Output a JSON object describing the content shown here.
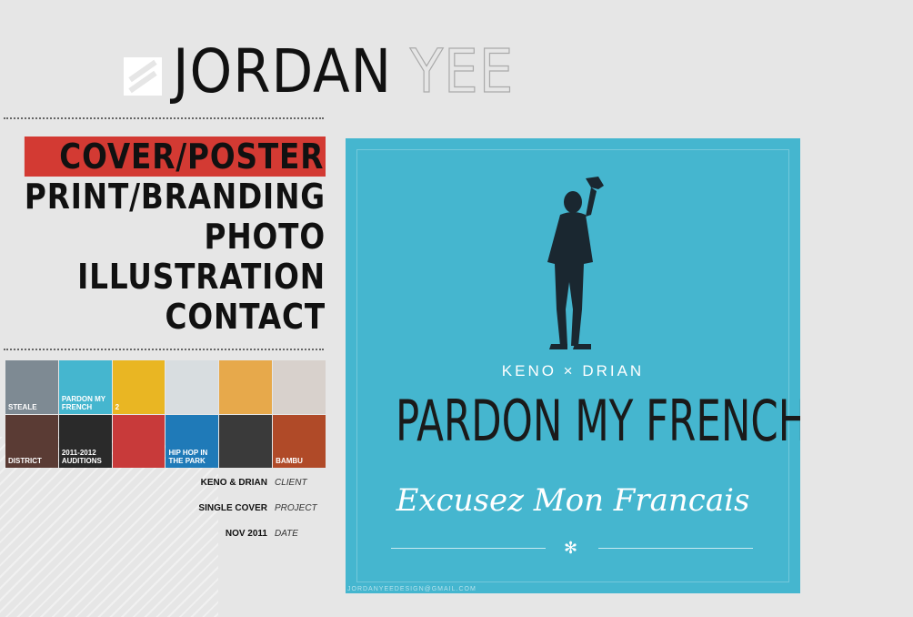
{
  "header": {
    "first_name": "JORDAN",
    "last_name": "YEE"
  },
  "nav": {
    "items": [
      {
        "label": "COVER/POSTER",
        "active": true
      },
      {
        "label": "PRINT/BRANDING",
        "active": false
      },
      {
        "label": "PHOTO",
        "active": false
      },
      {
        "label": "ILLUSTRATION",
        "active": false
      },
      {
        "label": "CONTACT",
        "active": false
      }
    ]
  },
  "thumbnails": [
    {
      "caption": "STEALE",
      "color": "#7e8a93"
    },
    {
      "caption": "PARDON MY FRENCH",
      "color": "#45b6cf"
    },
    {
      "caption": "2",
      "color": "#e9b623"
    },
    {
      "caption": "",
      "color": "#d8dde0"
    },
    {
      "caption": "",
      "color": "#e7a94b"
    },
    {
      "caption": "",
      "color": "#d8d1cc"
    },
    {
      "caption": "DISTRICT",
      "color": "#5a3b34"
    },
    {
      "caption": "2011-2012 AUDITIONS",
      "color": "#2a2a2a"
    },
    {
      "caption": "",
      "color": "#c83a3a"
    },
    {
      "caption": "HIP HOP IN THE PARK",
      "color": "#1f7ab8"
    },
    {
      "caption": "",
      "color": "#3a3a3a"
    },
    {
      "caption": "BAMBU",
      "color": "#b04a28"
    }
  ],
  "details": {
    "client_value": "KENO & DRIAN",
    "client_label": "CLIENT",
    "project_value": "SINGLE COVER",
    "project_label": "PROJECT",
    "date_value": "NOV 2011",
    "date_label": "DATE"
  },
  "poster": {
    "artist": "KENO × DRIAN",
    "title": "PARDON MY FRENCH",
    "subtitle": "Excusez Mon Francais",
    "footer": "JORDANYEEDESIGN@GMAIL.COM",
    "bg_color": "#45b6cf"
  }
}
